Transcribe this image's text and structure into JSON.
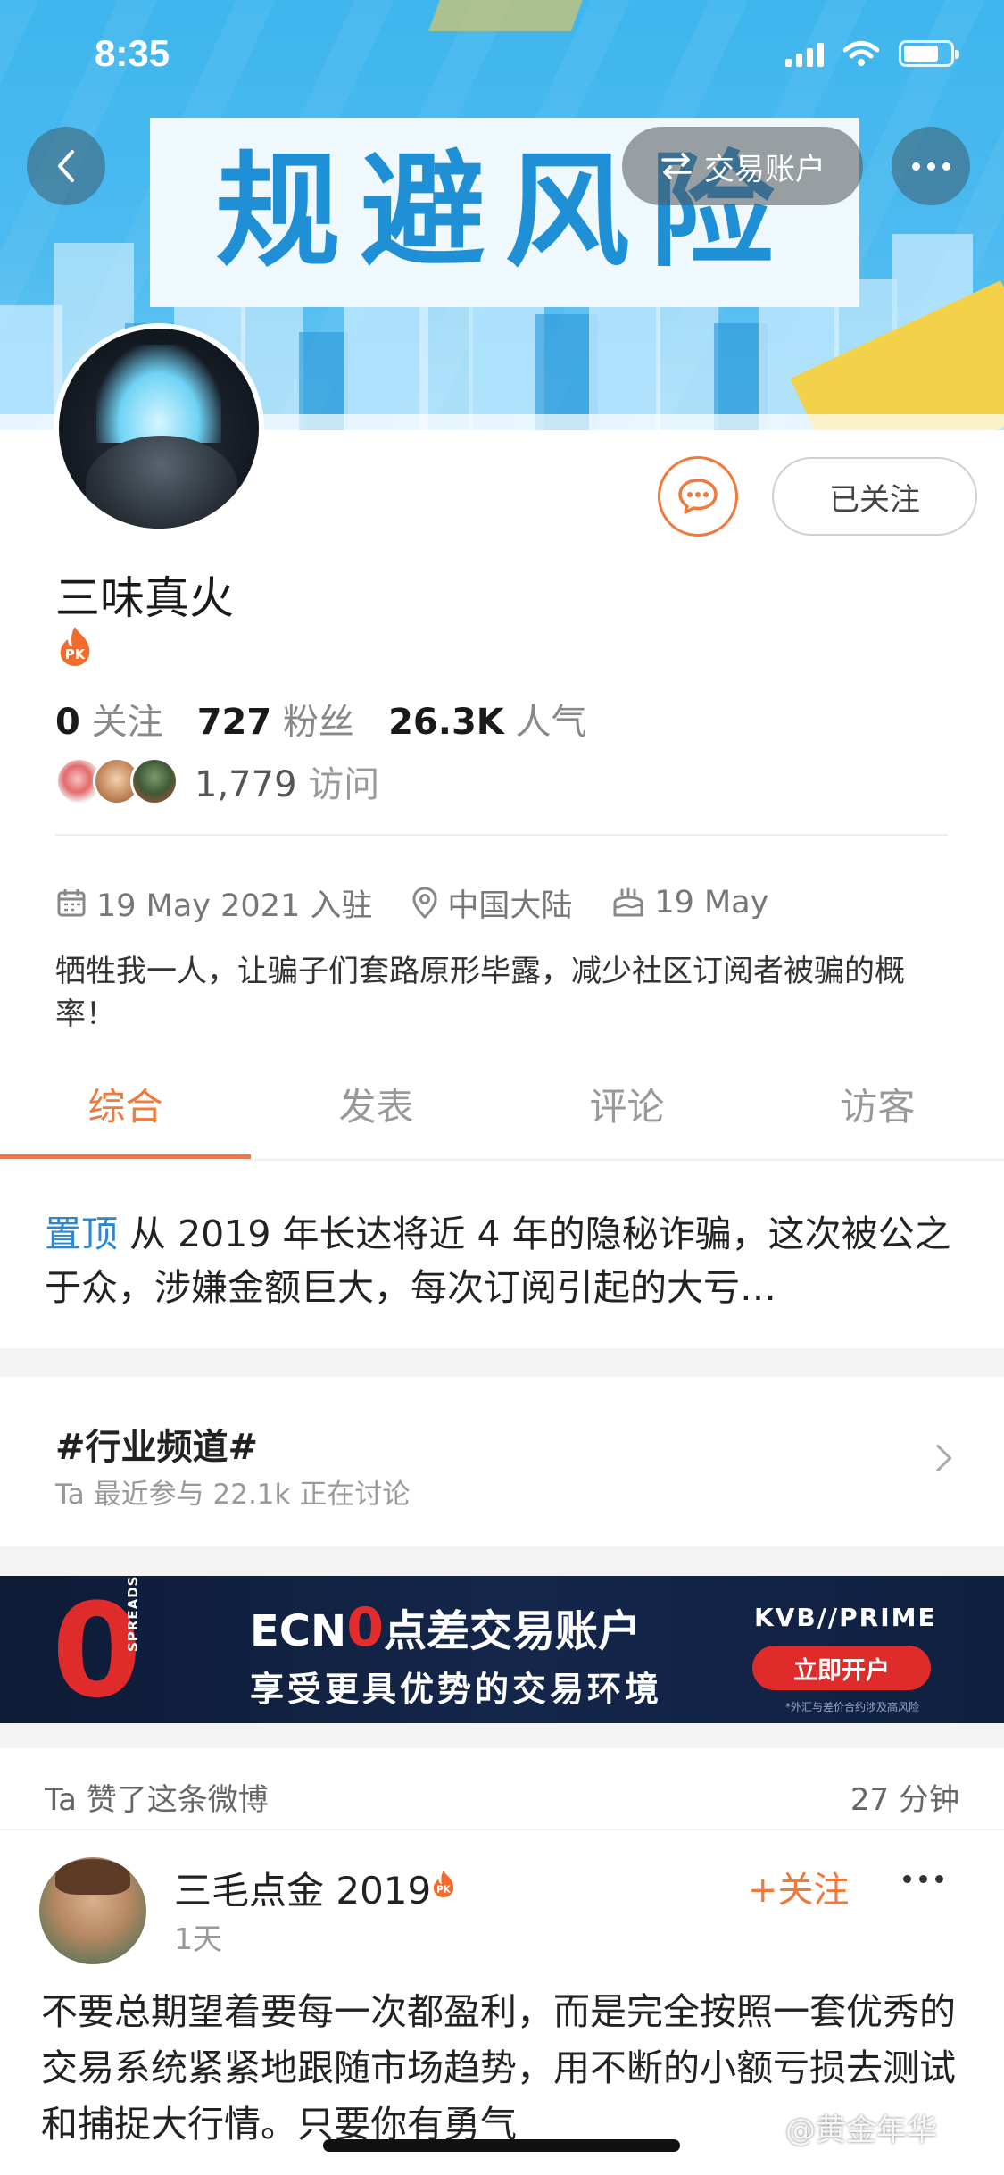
{
  "status_bar": {
    "time": "8:35"
  },
  "banner": {
    "title": "规避风险"
  },
  "nav": {
    "trade_account_label": "交易账户"
  },
  "profile": {
    "name": "三味真火",
    "follow_state_label": "已关注",
    "stats": [
      {
        "value": "0",
        "label": "关注"
      },
      {
        "value": "727",
        "label": "粉丝"
      },
      {
        "value": "26.3K",
        "label": "人气"
      }
    ],
    "visits": {
      "count": "1,779",
      "label": "访问"
    },
    "joined": "19 May 2021 入驻",
    "location": "中国大陆",
    "birthday": "19 May",
    "bio": "牺牲我一人，让骗子们套路原形毕露，减少社区订阅者被骗的概率！"
  },
  "tabs": [
    {
      "label": "综合",
      "active": true
    },
    {
      "label": "发表",
      "active": false
    },
    {
      "label": "评论",
      "active": false
    },
    {
      "label": "访客",
      "active": false
    }
  ],
  "pinned": {
    "tag": "置顶",
    "text": "从 2019 年长达将近 4 年的隐秘诈骗，这次被公之于众，涉嫌金额巨大，每次订阅引起的大亏…"
  },
  "topic": {
    "title": "#行业频道#",
    "subtitle": "Ta 最近参与  22.1k 正在讨论"
  },
  "ad": {
    "big_zero": "0",
    "spreads_label": "SPREADS",
    "headline_prefix": "ECN",
    "headline_zero": "0",
    "headline_suffix": "点差交易账户",
    "subline": "享受更具优势的交易环境",
    "brand": "KVB//PRIME",
    "cta": "立即开户",
    "fine_print": "*外汇与差价合约涉及高风险"
  },
  "activity": {
    "title": "Ta 赞了这条微博",
    "time": "27 分钟"
  },
  "post": {
    "author": "三毛点金 2019",
    "time": "1天",
    "follow_label": "+关注",
    "text": "不要总期望着要每一次都盈利，而是完全按照一套优秀的交易系统紧紧地跟随市场趋势，用不断的小额亏损去测试和捕捉大行情。只要你有勇气"
  },
  "watermark": "@黄金年华",
  "colors": {
    "accent": "#f0793b",
    "link": "#2b87d1",
    "ad_red": "#e02b2b"
  },
  "icons": [
    "back-arrow-icon",
    "swap-icon",
    "more-icon",
    "chat-icon",
    "pk-flame-icon",
    "calendar-icon",
    "location-pin-icon",
    "birthday-cake-icon",
    "chevron-right-icon"
  ]
}
